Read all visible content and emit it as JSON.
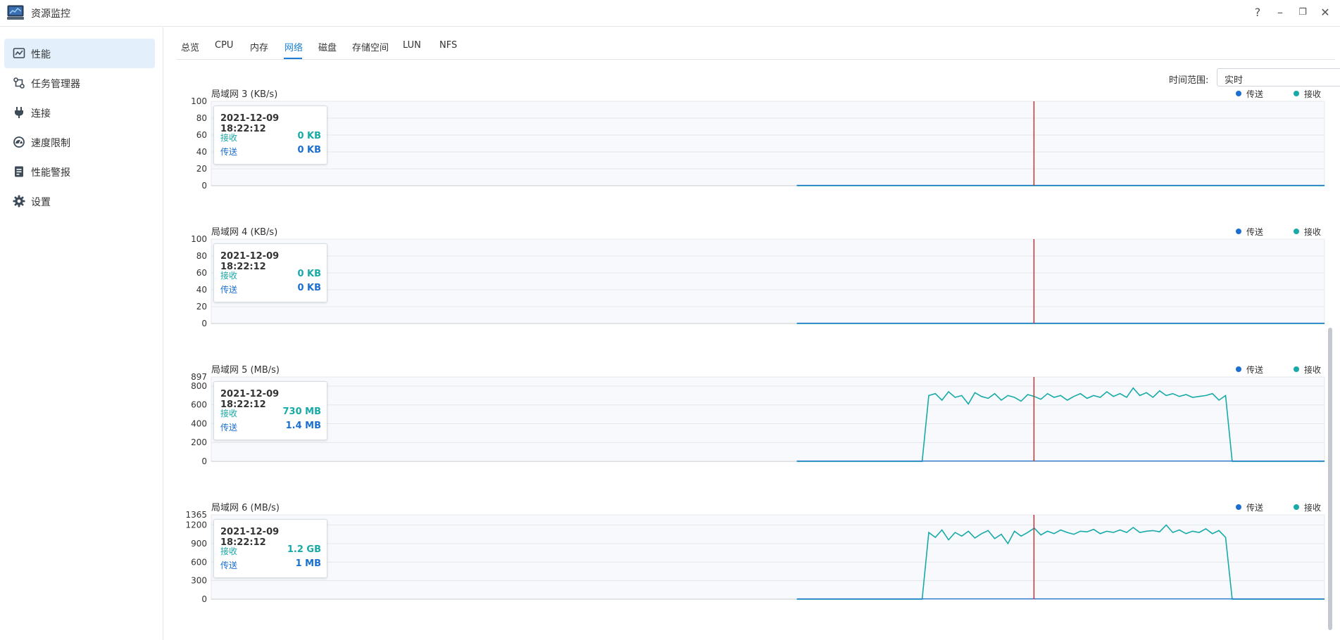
{
  "app": {
    "title": "资源监控"
  },
  "window_controls": {
    "help": "?",
    "minimize": "–",
    "restore": "❐",
    "close": "✕"
  },
  "sidebar": {
    "items": [
      {
        "label": "性能",
        "icon": "performance-icon",
        "active": true
      },
      {
        "label": "任务管理器",
        "icon": "task-manager-icon",
        "active": false
      },
      {
        "label": "连接",
        "icon": "plug-icon",
        "active": false
      },
      {
        "label": "速度限制",
        "icon": "speed-gauge-icon",
        "active": false
      },
      {
        "label": "性能警报",
        "icon": "clipboard-alert-icon",
        "active": false
      },
      {
        "label": "设置",
        "icon": "gear-icon",
        "active": false
      }
    ]
  },
  "tabs": [
    {
      "label": "总览",
      "active": false
    },
    {
      "label": "CPU",
      "active": false
    },
    {
      "label": "内存",
      "active": false
    },
    {
      "label": "网络",
      "active": true
    },
    {
      "label": "磁盘",
      "active": false
    },
    {
      "label": "存储空间",
      "active": false
    },
    {
      "label": "LUN",
      "active": false
    },
    {
      "label": "NFS",
      "active": false
    }
  ],
  "time_range": {
    "label": "时间范围:",
    "value": "实时"
  },
  "colors": {
    "send": "#1a6fd0",
    "receive": "#17aaa8",
    "cursor": "#c62828",
    "accent": "#1a7fd4"
  },
  "legend": {
    "send": "传送",
    "receive": "接收"
  },
  "chart_data": [
    {
      "type": "line",
      "title": "局域网 3 (KB/s)",
      "yticks": [
        "0",
        "20",
        "40",
        "60",
        "80",
        "100"
      ],
      "ylim": [
        0,
        100
      ],
      "series": [
        {
          "name": "传送",
          "values": [
            0,
            0
          ]
        },
        {
          "name": "接收",
          "values": [
            0,
            0
          ]
        }
      ],
      "tooltip": {
        "time": "2021-12-09 18:22:12",
        "receive_label": "接收",
        "receive_value": "0 KB",
        "send_label": "传送",
        "send_value": "0 KB"
      }
    },
    {
      "type": "line",
      "title": "局域网 4 (KB/s)",
      "yticks": [
        "0",
        "20",
        "40",
        "60",
        "80",
        "100"
      ],
      "ylim": [
        0,
        100
      ],
      "series": [
        {
          "name": "传送",
          "values": [
            0,
            0
          ]
        },
        {
          "name": "接收",
          "values": [
            0,
            0
          ]
        }
      ],
      "tooltip": {
        "time": "2021-12-09 18:22:12",
        "receive_label": "接收",
        "receive_value": "0 KB",
        "send_label": "传送",
        "send_value": "0 KB"
      }
    },
    {
      "type": "line",
      "title": "局域网 5 (MB/s)",
      "yticks": [
        "0",
        "200",
        "400",
        "600",
        "800",
        "897"
      ],
      "ylim": [
        0,
        897
      ],
      "series": [
        {
          "name": "传送",
          "values": [
            0,
            0
          ]
        },
        {
          "name": "接收",
          "values": [
            0,
            0,
            0,
            0,
            0,
            0,
            0,
            0,
            0,
            0,
            0,
            0,
            0,
            0,
            0,
            0,
            0,
            0,
            0,
            0,
            700,
            720,
            650,
            740,
            680,
            700,
            610,
            730,
            690,
            670,
            720,
            650,
            700,
            680,
            640,
            710,
            690,
            660,
            720,
            680,
            700,
            650,
            690,
            720,
            670,
            700,
            680,
            740,
            690,
            720,
            680,
            780,
            700,
            730,
            680,
            750,
            700,
            720,
            690,
            710,
            680,
            690,
            700,
            720,
            650,
            700,
            0,
            0,
            0,
            0,
            0,
            0,
            0,
            0,
            0,
            0,
            0,
            0,
            0,
            0,
            0
          ]
        }
      ],
      "tooltip": {
        "time": "2021-12-09 18:22:12",
        "receive_label": "接收",
        "receive_value": "730 MB",
        "send_label": "传送",
        "send_value": "1.4 MB"
      }
    },
    {
      "type": "line",
      "title": "局域网 6 (MB/s)",
      "yticks": [
        "0",
        "300",
        "600",
        "900",
        "1200",
        "1365"
      ],
      "ylim": [
        0,
        1365
      ],
      "series": [
        {
          "name": "传送",
          "values": [
            0,
            0
          ]
        },
        {
          "name": "接收",
          "values": [
            0,
            0,
            0,
            0,
            0,
            0,
            0,
            0,
            0,
            0,
            0,
            0,
            0,
            0,
            0,
            0,
            0,
            0,
            0,
            0,
            1080,
            1000,
            1120,
            960,
            1080,
            1020,
            1100,
            990,
            1060,
            1110,
            980,
            1050,
            900,
            1100,
            1020,
            1080,
            1150,
            1040,
            1100,
            1060,
            1120,
            1080,
            1050,
            1100,
            1090,
            1130,
            1060,
            1100,
            1080,
            1120,
            1080,
            1160,
            1080,
            1100,
            1110,
            1090,
            1200,
            1080,
            1120,
            1060,
            1100,
            1080,
            1140,
            1060,
            1110,
            1000,
            0,
            0,
            0,
            0,
            0,
            0,
            0,
            0,
            0,
            0,
            0,
            0,
            0,
            0,
            0
          ]
        }
      ],
      "tooltip": {
        "time": "2021-12-09 18:22:12",
        "receive_label": "接收",
        "receive_value": "1.2 GB",
        "send_label": "传送",
        "send_value": "1 MB"
      }
    }
  ]
}
